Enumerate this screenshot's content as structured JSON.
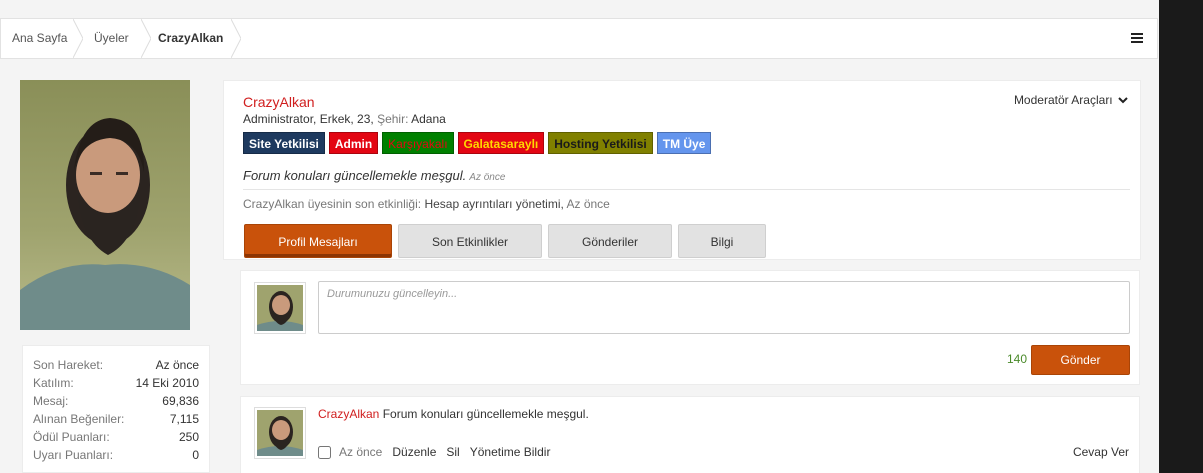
{
  "breadcrumb": [
    "Ana Sayfa",
    "Üyeler",
    "CrazyAlkan"
  ],
  "profile": {
    "username": "CrazyAlkan",
    "info_prefix": "Administrator, Erkek, 23, ",
    "city_label": "Şehir:",
    "city": "Adana",
    "moderator_tools": "Moderatör Araçları",
    "badges": [
      {
        "label": "Site Yetkilisi",
        "bg": "#1e3a5f",
        "color": "#ffffff"
      },
      {
        "label": "Admin",
        "bg": "#e30613",
        "color": "#ffffff"
      },
      {
        "label": "Karşıyakalı",
        "bg": "#008000",
        "color": "#e30613"
      },
      {
        "label": "Galatasaraylı",
        "bg": "#e30613",
        "color": "#ffd700"
      },
      {
        "label": "Hosting Yetkilisi",
        "bg": "#808000",
        "color": "#1a1a1a"
      },
      {
        "label": "TM Üye",
        "bg": "#6495ed",
        "color": "#ffffff"
      }
    ],
    "status": "Forum konuları güncellemekle meşgul.",
    "status_time": "Az önce",
    "activity_prefix": "CrazyAlkan üyesinin son etkinliği:",
    "activity_action": "Hesap ayrıntıları yönetimi,",
    "activity_time": "Az önce"
  },
  "tabs": [
    "Profil Mesajları",
    "Son Etkinlikler",
    "Gönderiler",
    "Bilgi"
  ],
  "stats": [
    {
      "label": "Son Hareket:",
      "value": "Az önce"
    },
    {
      "label": "Katılım:",
      "value": "14 Eki 2010"
    },
    {
      "label": "Mesaj:",
      "value": "69,836"
    },
    {
      "label": "Alınan Beğeniler:",
      "value": "7,115"
    },
    {
      "label": "Ödül Puanları:",
      "value": "250"
    },
    {
      "label": "Uyarı Puanları:",
      "value": "0"
    }
  ],
  "composer": {
    "placeholder": "Durumunuzu güncelleyin...",
    "char_count": "140",
    "send_label": "Gönder"
  },
  "message": {
    "author": "CrazyAlkan",
    "text": "Forum konuları güncellemekle meşgul.",
    "time": "Az önce",
    "actions": [
      "Düzenle",
      "Sil",
      "Yönetime Bildir"
    ],
    "reply": "Cevap Ver"
  },
  "colors": {
    "accent": "#c9520b",
    "username": "#d01e1e"
  },
  "icons": {
    "menu": "hamburger-icon",
    "dropdown": "chevron-down-icon"
  }
}
